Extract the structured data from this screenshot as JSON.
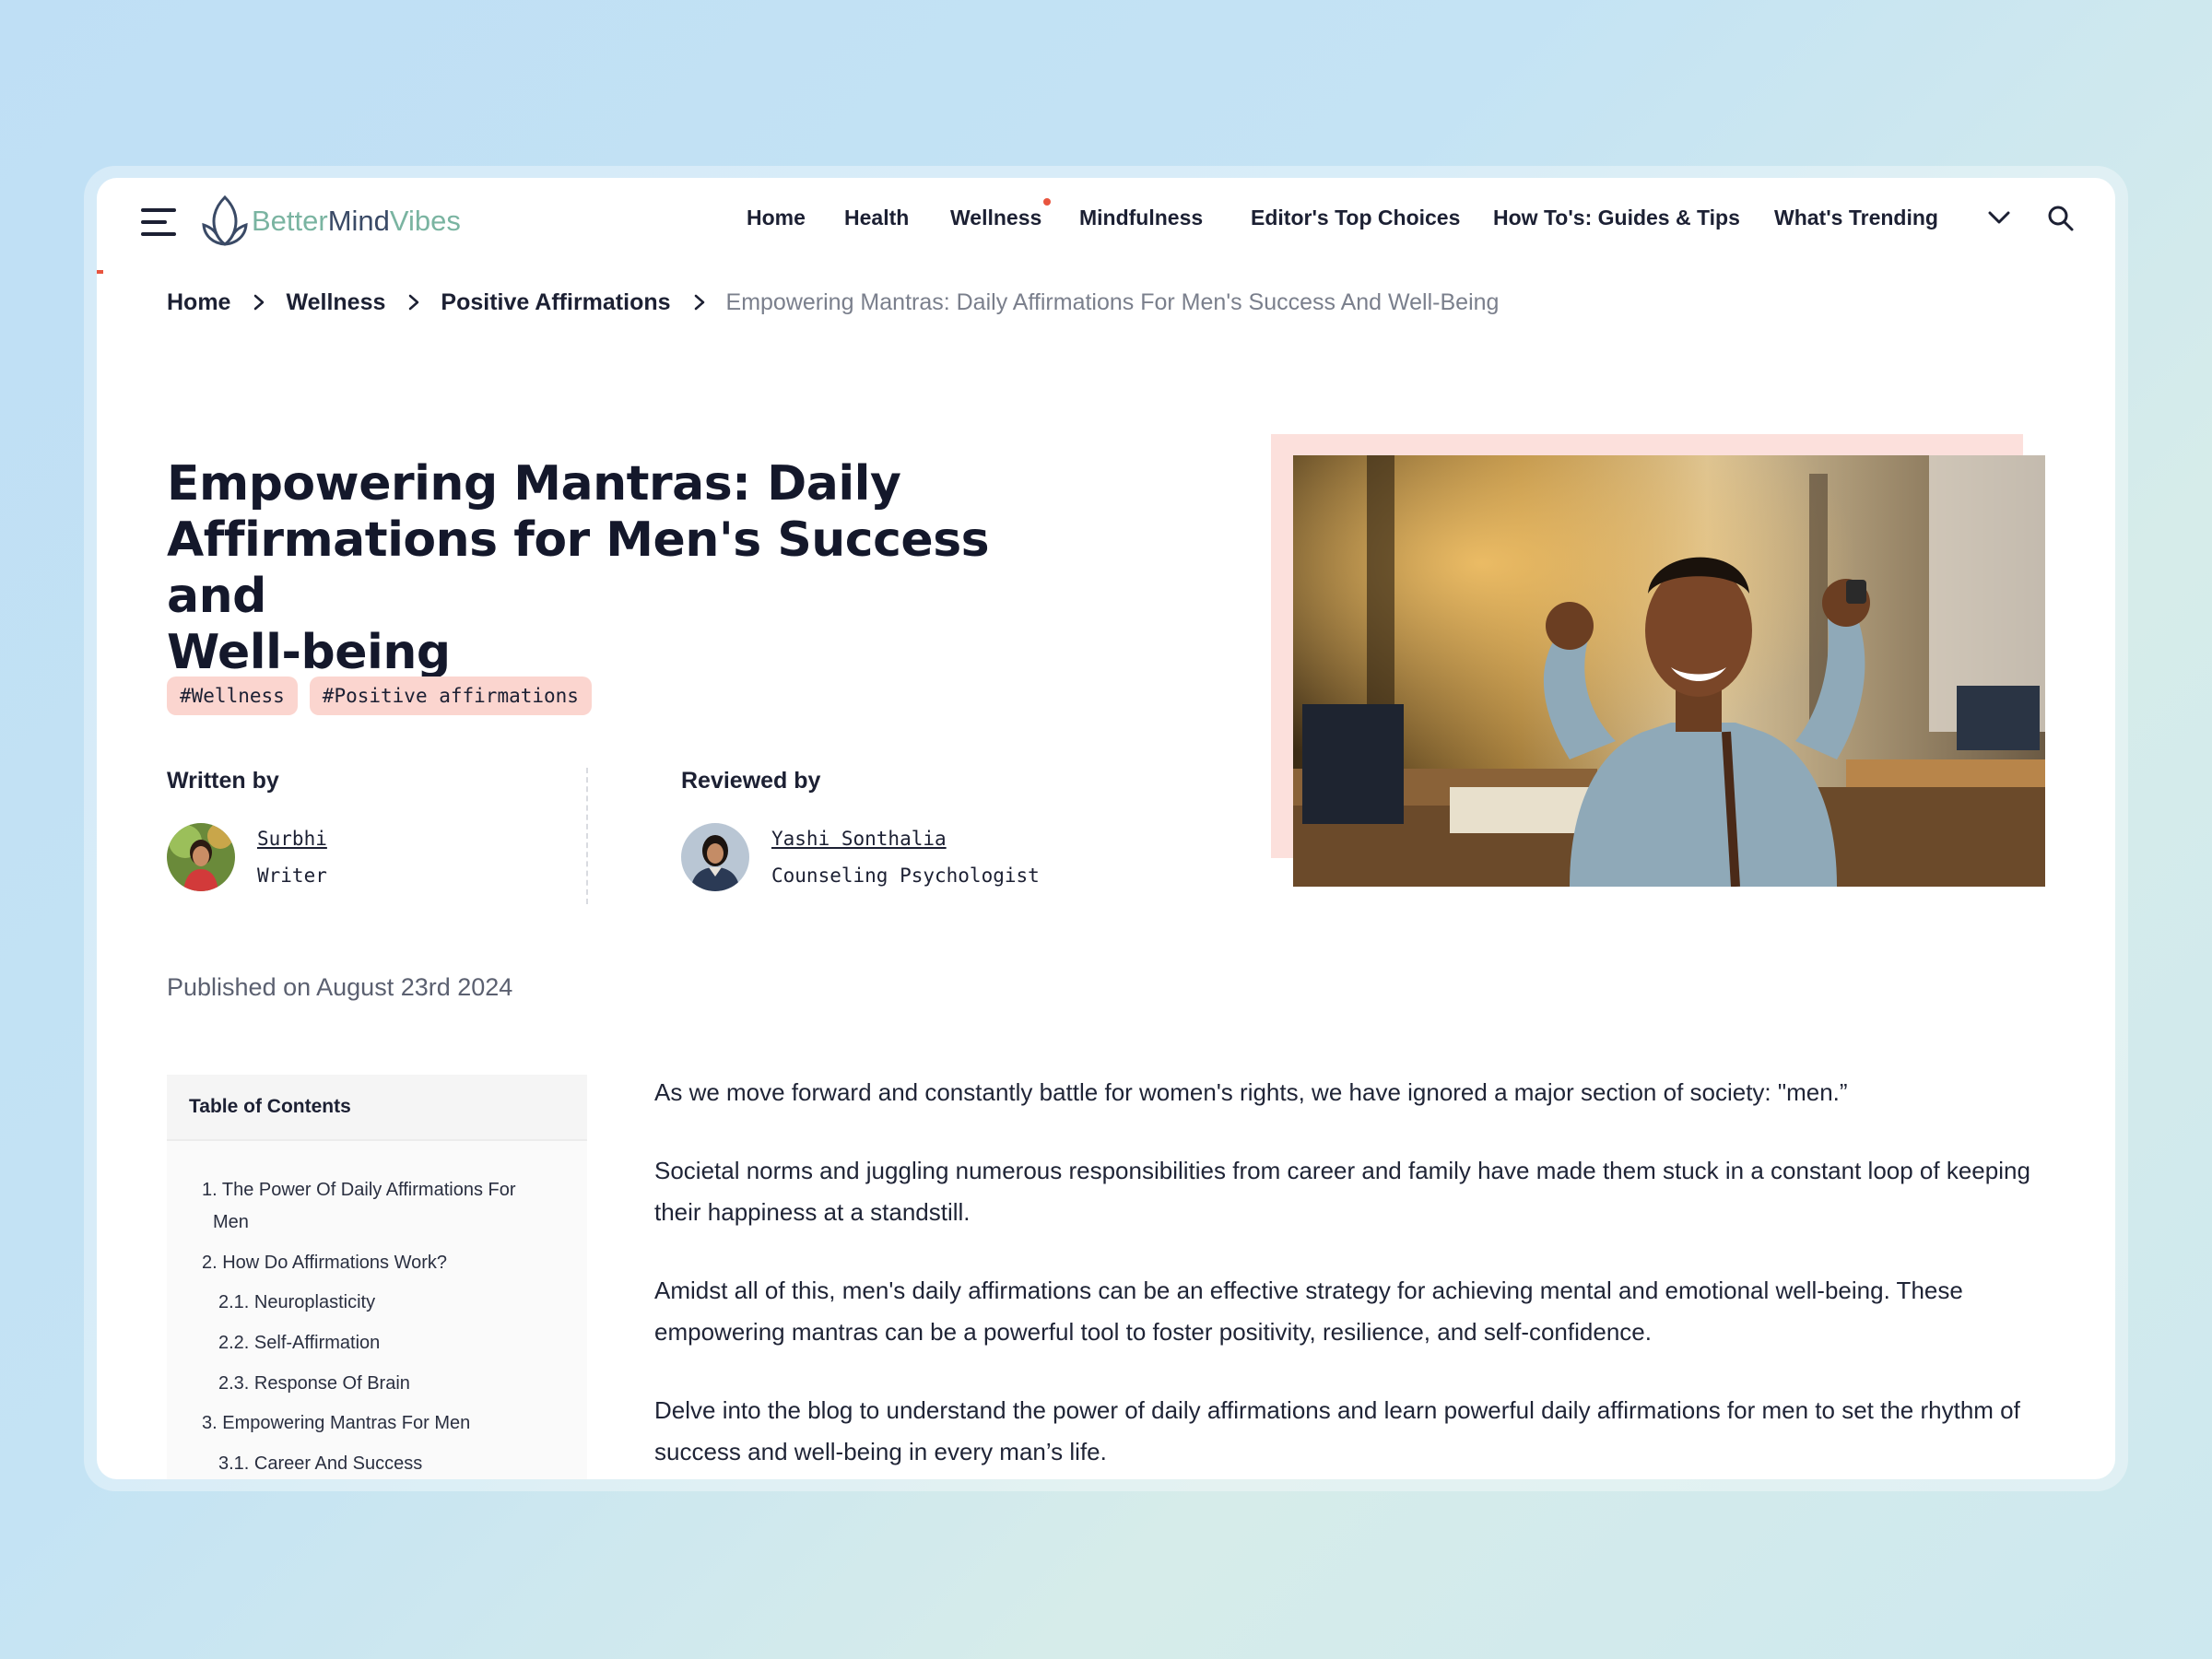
{
  "logo": {
    "part1": "Better",
    "part2": "Mind",
    "part3": "Vibes"
  },
  "nav": {
    "items": [
      {
        "label": "Home"
      },
      {
        "label": "Health"
      },
      {
        "label": "Wellness"
      },
      {
        "label": "Mindfulness"
      },
      {
        "label": "Editor's Top Choices"
      },
      {
        "label": "How To's: Guides & Tips"
      },
      {
        "label": "What's Trending"
      }
    ],
    "more_icon": "chevron-down-icon",
    "search_icon": "search-icon"
  },
  "breadcrumb": {
    "items": [
      "Home",
      "Wellness",
      "Positive Affirmations"
    ],
    "current": "Empowering Mantras: Daily Affirmations For Men's Success And Well-Being"
  },
  "article": {
    "title_lines": [
      "Empowering Mantras: Daily",
      "Affirmations for Men's Success and",
      "Well-being"
    ],
    "tags": [
      "#Wellness",
      "#Positive affirmations"
    ],
    "written_by_label": "Written by",
    "author": {
      "name": "Surbhi",
      "role": "Writer"
    },
    "reviewed_by_label": "Reviewed by",
    "reviewer": {
      "name": "Yashi Sonthalia",
      "role": "Counseling Psychologist"
    },
    "published": "Published on August 23rd 2024",
    "paragraphs": [
      "As we move forward and constantly battle for women's rights, we have ignored a major section of society: \"men.”",
      "Societal norms and juggling numerous responsibilities from career and family have made them stuck in a constant loop of keeping their happiness at a standstill.",
      "Amidst all of this, men's daily affirmations can be an effective strategy for achieving mental and emotional well-being. These empowering mantras can be a powerful tool to foster positivity, resilience, and self-confidence.",
      "Delve into the blog to understand the power of daily affirmations and learn powerful daily affirmations for men to set the rhythm of success and well-being in every man’s life."
    ]
  },
  "toc": {
    "heading": "Table of Contents",
    "items": [
      {
        "label": "1. The Power Of Daily Affirmations For"
      },
      {
        "label": "Men"
      },
      {
        "label": "2. How Do Affirmations Work?"
      },
      {
        "label": "2.1. Neuroplasticity"
      },
      {
        "label": "2.2. Self-Affirmation"
      },
      {
        "label": "2.3. Response Of Brain"
      },
      {
        "label": "3. Empowering Mantras For Men"
      },
      {
        "label": "3.1. Career And Success"
      }
    ]
  },
  "colors": {
    "accent": "#e8553f",
    "tag_bg": "#fbd5cf",
    "hero_frame": "#fce0dc",
    "logo_green": "#7ab4a1",
    "text": "#1c2033"
  }
}
